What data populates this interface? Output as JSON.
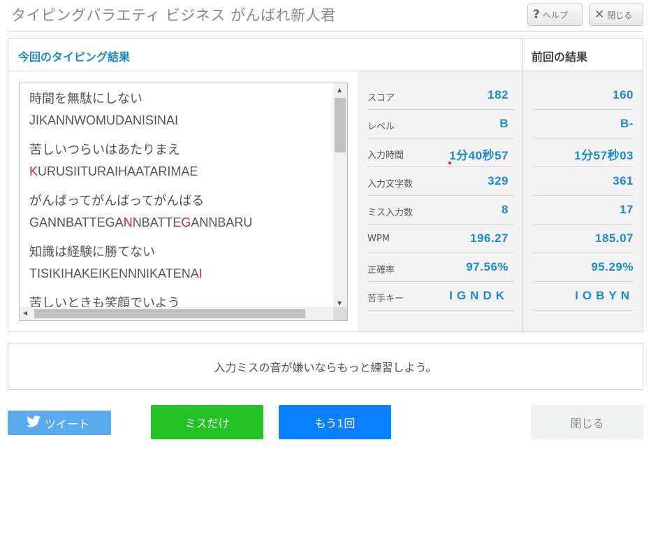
{
  "header": {
    "title": "タイピングバラエティ ビジネス がんばれ新人君",
    "help_label": "ヘルプ",
    "close_label": "閉じる"
  },
  "results": {
    "current_title": "今回のタイピング結果",
    "previous_title": "前回の結果",
    "entries": [
      {
        "jp": "時間を無駄にしない",
        "romaji": [
          {
            "t": "JIKANNWOMUDANISINAI",
            "miss": false
          }
        ]
      },
      {
        "jp": "苦しいつらいはあたりまえ",
        "romaji": [
          {
            "t": "K",
            "miss": true
          },
          {
            "t": "URUSIITURAIHAATARIMAE",
            "miss": false
          }
        ]
      },
      {
        "jp": "がんばってがんばってがんばる",
        "romaji": [
          {
            "t": "GANNBATTEGA",
            "miss": false
          },
          {
            "t": "N",
            "miss": true
          },
          {
            "t": "NBATTE",
            "miss": false
          },
          {
            "t": "G",
            "miss": true
          },
          {
            "t": "ANNBARU",
            "miss": false
          }
        ]
      },
      {
        "jp": "知識は経験に勝てない",
        "romaji": [
          {
            "t": "TISIKIHAKEIKENNNIKATENA",
            "miss": false
          },
          {
            "t": "I",
            "miss": true
          }
        ]
      },
      {
        "jp": "苦しいときも笑顔でいよう",
        "romaji": []
      }
    ],
    "stats": [
      {
        "label": "スコア",
        "current": "182",
        "previous": "160"
      },
      {
        "label": "レベル",
        "current": "B",
        "previous": "B-"
      },
      {
        "label": "入力時間",
        "current": "1分40秒57",
        "previous": "1分57秒03"
      },
      {
        "label": "入力文字数",
        "current": "329",
        "previous": "361"
      },
      {
        "label": "ミス入力数",
        "current": "8",
        "previous": "17"
      },
      {
        "label": "WPM",
        "current": "196.27",
        "previous": "185.07"
      },
      {
        "label": "正確率",
        "current": "97.56%",
        "previous": "95.29%"
      },
      {
        "label": "苦手キー",
        "current": "IGNDK",
        "previous": "IOBYN"
      }
    ]
  },
  "message": "入力ミスの音が嫌いならもっと練習しよう。",
  "buttons": {
    "tweet": "ツイート",
    "miss_only": "ミスだけ",
    "again": "もう1回",
    "close": "閉じる"
  },
  "colors": {
    "accent": "#1a8ad6",
    "miss": "#e02020",
    "tweet": "#5aaaf0",
    "miss_only": "#24c224",
    "again": "#0a80ff"
  },
  "icons": {
    "help": "question-icon",
    "close": "x-icon",
    "tweet": "twitter-bird-icon"
  }
}
